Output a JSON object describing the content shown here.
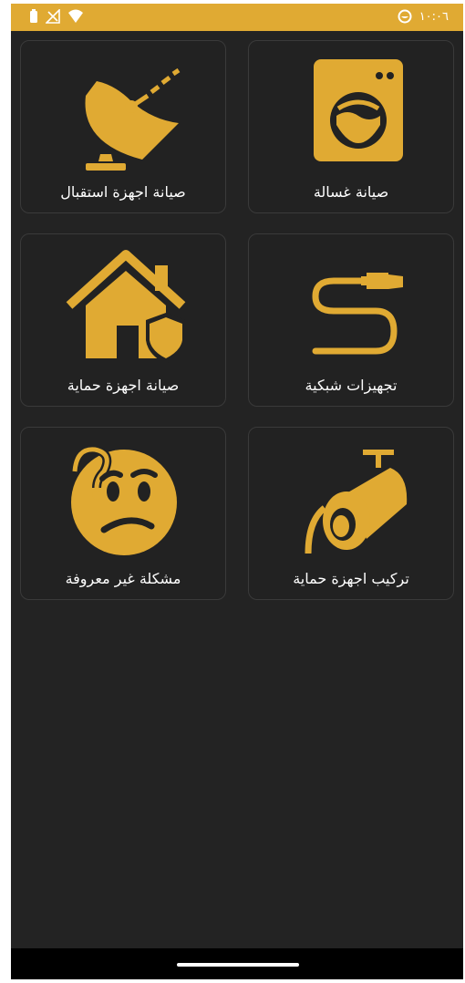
{
  "status_bar": {
    "time": "١٠:٠٦",
    "left_icons": [
      "battery-icon",
      "no-signal-icon",
      "wifi-icon"
    ],
    "right_icons": [
      "data-saver-icon"
    ],
    "background": "#E0AA33"
  },
  "services": [
    {
      "label": "صيانة غسالة",
      "icon": "washing-machine-icon"
    },
    {
      "label": "صيانة اجهزة استقبال",
      "icon": "satellite-dish-icon"
    },
    {
      "label": "تجهيزات شبكية",
      "icon": "network-cable-icon"
    },
    {
      "label": "صيانة اجهزة حماية",
      "icon": "home-security-icon"
    },
    {
      "label": "تركيب اجهزة حماية",
      "icon": "security-camera-icon"
    },
    {
      "label": "مشكلة غير معروفة",
      "icon": "confused-face-icon"
    }
  ],
  "colors": {
    "accent": "#E0AA33",
    "background": "#232323",
    "card": "#222222",
    "text": "#FFFFFF"
  }
}
